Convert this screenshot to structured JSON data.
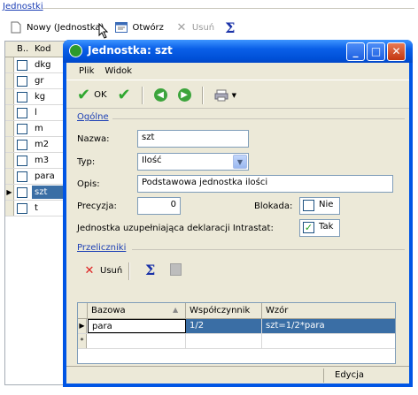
{
  "bg": {
    "title": "Jednostki",
    "toolbar": {
      "new_label": "Nowy (Jednostka)",
      "open_label": "Otwórz",
      "delete_label": "Usuń"
    },
    "grid": {
      "col_b": "B..",
      "col_kod": "Kod",
      "rows": [
        "dkg",
        "gr",
        "kg",
        "l",
        "m",
        "m2",
        "m3",
        "para",
        "szt",
        "t"
      ]
    }
  },
  "dialog": {
    "title": "Jednostka: szt",
    "menu": {
      "file": "Plik",
      "view": "Widok"
    },
    "toolbar": {
      "ok_label": "OK"
    },
    "general": {
      "section": "Ogólne",
      "name_label": "Nazwa:",
      "name_value": "szt",
      "type_label": "Typ:",
      "type_value": "Ilość",
      "desc_label": "Opis:",
      "desc_value": "Podstawowa jednostka ilości",
      "precision_label": "Precyzja:",
      "precision_value": "0",
      "lock_label": "Blokada:",
      "lock_value": "Nie",
      "intrastat_label": "Jednostka uzupełniająca deklaracji Intrastat:",
      "intrastat_value": "Tak"
    },
    "converters": {
      "section": "Przeliczniki",
      "delete_label": "Usuń",
      "columns": [
        "Bazowa",
        "Współczynnik",
        "Wzór"
      ],
      "rows": [
        {
          "bazowa": "para",
          "wsp": "1/2",
          "wzor": "szt=1/2*para"
        }
      ],
      "new_row_marker": "*"
    },
    "status": "Edycja"
  }
}
